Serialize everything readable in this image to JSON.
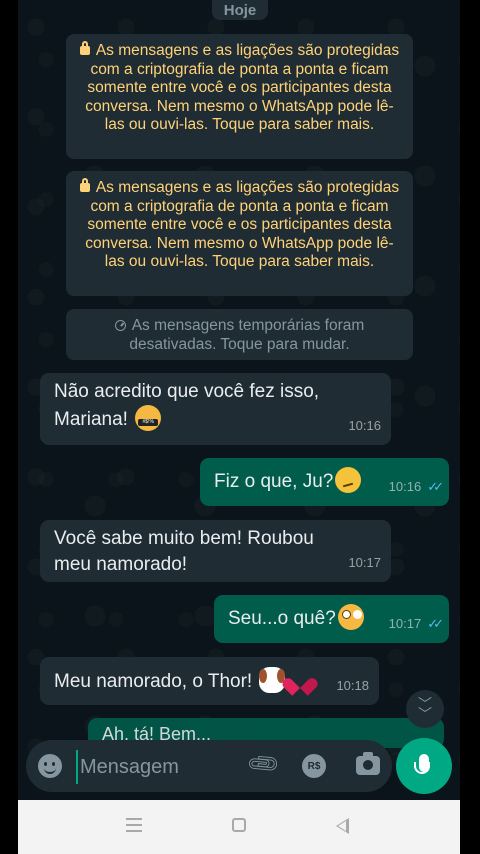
{
  "chat": {
    "day_label": "Hoje",
    "encryption_notice_1": "As mensagens e as ligações são protegidas com a criptografia de ponta a ponta e ficam somente entre você e os participantes desta conversa. Nem mesmo o WhatsApp pode lê-las ou ouvi-las. Toque para saber mais.",
    "encryption_notice_2": "As mensagens e as ligações são protegidas com a criptografia de ponta a ponta e ficam somente entre você e os participantes desta conversa. Nem mesmo o WhatsApp pode lê-las ou ouvi-las. Toque para saber mais.",
    "temporary_notice": "As mensagens temporárias foram desativadas. Toque para mudar.",
    "messages": [
      {
        "direction": "in",
        "text": "Não acredito que você fez isso, Mariana!",
        "emoji": "cursing-face",
        "time": "10:16"
      },
      {
        "direction": "out",
        "text": "Fiz o que, Ju?",
        "emoji": "confused-face",
        "time": "10:16",
        "status": "read"
      },
      {
        "direction": "in",
        "text": "Você sabe muito bem! Roubou meu namorado!",
        "time": "10:17"
      },
      {
        "direction": "out",
        "text": "Seu...o quê?",
        "emoji": "flushed-face",
        "time": "10:17",
        "status": "read"
      },
      {
        "direction": "in",
        "text": "Meu namorado, o Thor!",
        "emoji": "dog-face broken-heart",
        "time": "10:18"
      }
    ],
    "peek_text": "Ah, tá! Bem..."
  },
  "composer": {
    "placeholder": "Mensagem",
    "currency_label": "R$"
  },
  "colors": {
    "background": "#0b141a",
    "incoming": "#1f2c33",
    "outgoing": "#005c4b",
    "accent": "#00a884",
    "notice_text": "#ffd279",
    "read_ticks": "#53bdeb"
  }
}
